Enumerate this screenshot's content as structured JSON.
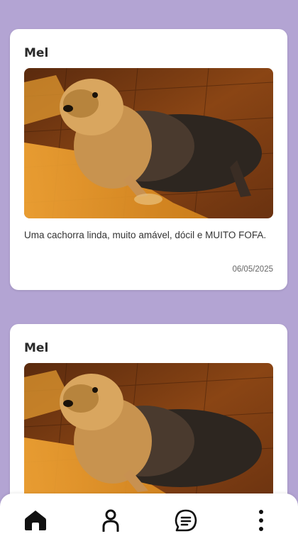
{
  "posts": [
    {
      "name": "Mel",
      "description": "Uma cachorra linda, muito amável, dócil e MUITO FOFA.",
      "date": "06/05/2025",
      "image": "yorkshire-terrier-photo"
    },
    {
      "name": "Mel",
      "image": "yorkshire-terrier-photo"
    }
  ],
  "nav": {
    "items": [
      "home-icon",
      "profile-icon",
      "chat-icon",
      "more-vertical-icon"
    ],
    "active": "home-icon"
  },
  "colors": {
    "background": "#b3a4d3",
    "card": "#ffffff",
    "nav_icon": "#111111"
  }
}
